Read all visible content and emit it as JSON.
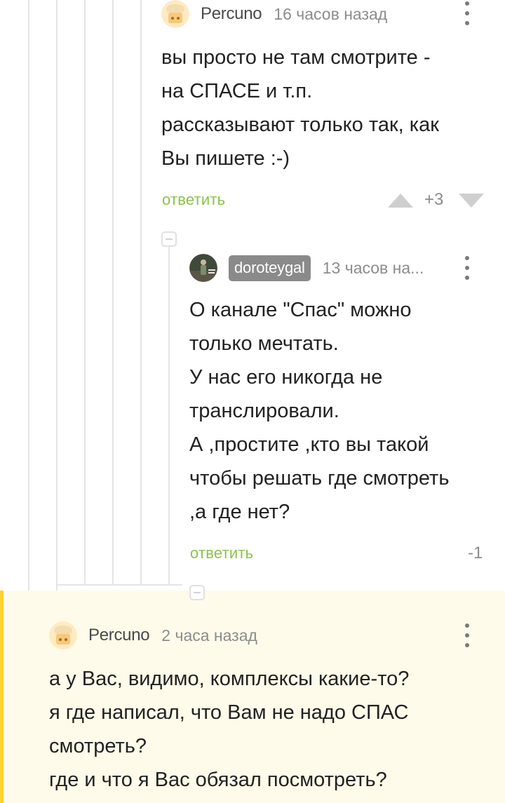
{
  "comments": [
    {
      "author": "Percuno",
      "time": "16 часов назад",
      "body": [
        "вы просто не там смотрите -",
        "на СПАСЕ и т.п.",
        "рассказывают только так, как",
        "Вы пишете :-)"
      ],
      "reply_label": "ответить",
      "rating": "+3"
    },
    {
      "author": "doroteygal",
      "time": "13 часов на...",
      "body": [
        "О канале \"Спас\" можно",
        "только мечтать.",
        "У нас его никогда не",
        "транслировали.",
        "А ,простите ,кто вы такой",
        "чтобы решать где смотреть",
        ",а где нет?"
      ],
      "reply_label": "ответить",
      "rating": "-1"
    },
    {
      "author": "Percuno",
      "time": "2 часа назад",
      "body": [
        "а у Вас, видимо, комплексы какие-то?",
        "я где написал, что Вам не надо СПАС",
        "смотреть?",
        "где и что я Вас обязал посмотреть?"
      ]
    }
  ],
  "colors": {
    "reply_link": "#8bc34a",
    "highlight_bg": "#fffbea",
    "highlight_bar": "#ffd233",
    "thread_line": "#e4e4e4"
  },
  "icons": {
    "percuno_avatar": "chef-hat-avatar",
    "doroteygal_avatar": "photo-avatar",
    "more": "vertical-dots-icon",
    "upvote": "triangle-up-icon",
    "downvote": "triangle-down-icon",
    "collapse": "collapse-minus-icon"
  }
}
